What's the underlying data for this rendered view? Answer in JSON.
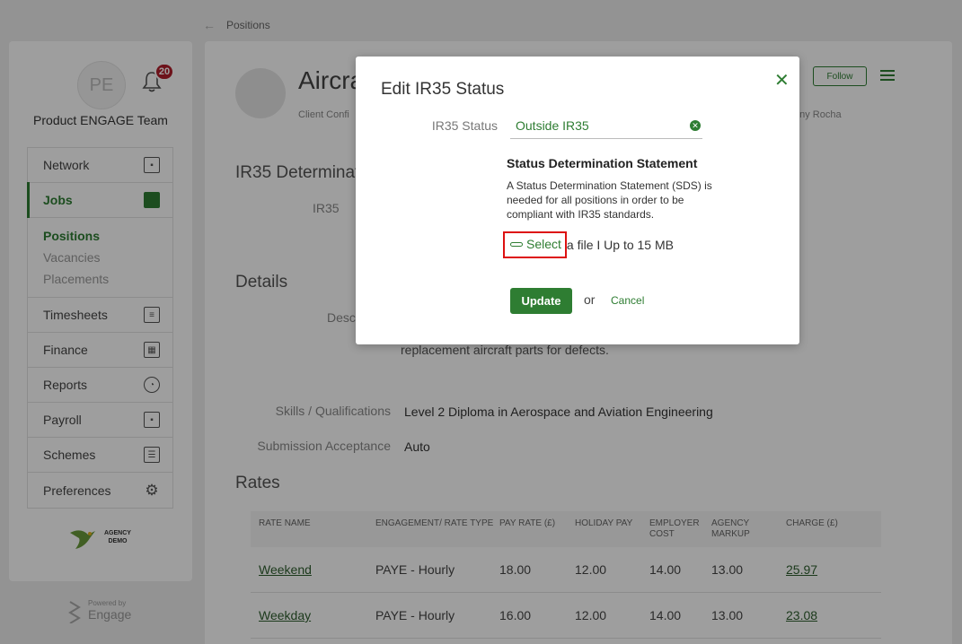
{
  "breadcrumb": {
    "back_icon": "back-arrow-icon",
    "label": "Positions"
  },
  "sidebar": {
    "avatar_initials": "PE",
    "notifications_count": "20",
    "team_name": "Product ENGAGE Team",
    "items": [
      {
        "label": "Network",
        "icon": "contact-card-icon"
      },
      {
        "label": "Jobs",
        "icon": "briefcase-icon"
      },
      {
        "label": "Timesheets",
        "icon": "timesheet-icon"
      },
      {
        "label": "Finance",
        "icon": "calculator-icon"
      },
      {
        "label": "Reports",
        "icon": "pie-chart-icon"
      },
      {
        "label": "Payroll",
        "icon": "payroll-icon"
      },
      {
        "label": "Schemes",
        "icon": "sliders-icon"
      },
      {
        "label": "Preferences",
        "icon": "gear-icon"
      }
    ],
    "subitems": [
      "Positions",
      "Vacancies",
      "Placements"
    ],
    "logo_text_1": "AGENCY",
    "logo_text_2": "DEMO",
    "powered_by": "Powered by",
    "powered_brand": "Engage"
  },
  "position": {
    "title": "Aircra",
    "client": "Client Confi",
    "person": "ony Rocha",
    "follow_label": "Follow",
    "ir35_heading": "IR35 Determinat",
    "ir35_label": "IR35",
    "details_heading": "Details",
    "desc_label": "Desc",
    "desc_text": "replacement aircraft parts for defects.",
    "skills_label": "Skills / Qualifications",
    "skills_value": "Level 2 Diploma in Aerospace and Aviation Engineering",
    "submission_label": "Submission Acceptance",
    "submission_value": "Auto",
    "rates_heading": "Rates"
  },
  "rates_table": {
    "headers": [
      "RATE NAME",
      "ENGAGEMENT/ RATE TYPE",
      "PAY RATE (£)",
      "HOLIDAY PAY",
      "EMPLOYER COST",
      "AGENCY MARKUP",
      "CHARGE (£)"
    ],
    "rows": [
      [
        "Weekend",
        "PAYE - Hourly",
        "18.00",
        "12.00",
        "14.00",
        "13.00",
        "25.97"
      ],
      [
        "Weekday",
        "PAYE - Hourly",
        "16.00",
        "12.00",
        "14.00",
        "13.00",
        "23.08"
      ]
    ]
  },
  "modal": {
    "title": "Edit IR35 Status",
    "status_label": "IR35 Status",
    "status_value": "Outside IR35",
    "sds_title": "Status Determination Statement",
    "sds_text": "A Status Determination Statement (SDS) is needed for all positions in order to be compliant with IR35 standards.",
    "select_label": "Select",
    "select_suffix": "a file I Up to 15 MB",
    "update_label": "Update",
    "or_text": "or",
    "cancel_label": "Cancel"
  }
}
